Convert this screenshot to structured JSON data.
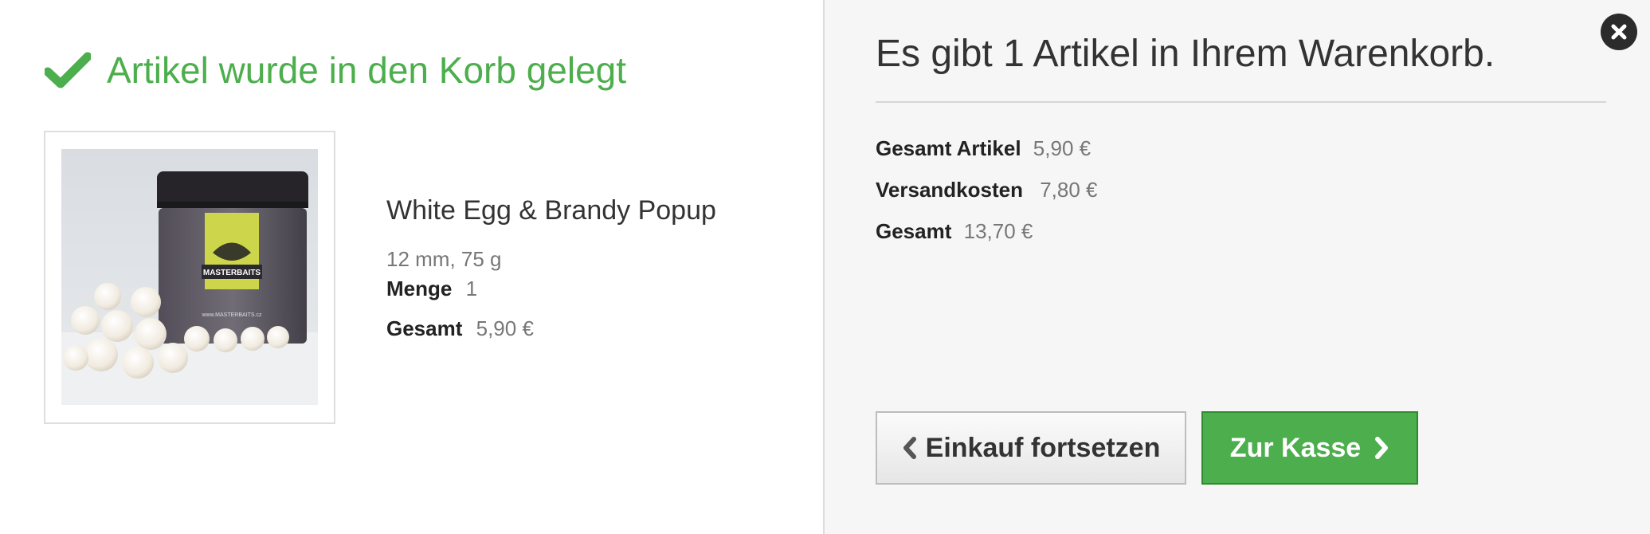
{
  "left": {
    "added_title": "Artikel wurde in den Korb gelegt",
    "product": {
      "name": "White Egg & Brandy Popup",
      "variant": "12 mm, 75 g",
      "quantity_label": "Menge",
      "quantity_value": "1",
      "total_label": "Gesamt",
      "total_value": "5,90 €",
      "image_brand": "MASTERBAITS"
    }
  },
  "right": {
    "cart_title": "Es gibt 1 Artikel in Ihrem Warenkorb.",
    "summary": {
      "items_label": "Gesamt Artikel",
      "items_value": "5,90 €",
      "shipping_label": "Versandkosten",
      "shipping_value": "7,80 €",
      "total_label": "Gesamt",
      "total_value": "13,70 €"
    },
    "continue_label": "Einkauf fortsetzen",
    "checkout_label": "Zur Kasse"
  },
  "icons": {
    "check": "check-icon",
    "close": "close-icon",
    "chevron_left": "chevron-left-icon",
    "chevron_right": "chevron-right-icon"
  },
  "colors": {
    "accent_green": "#4cae4c",
    "close_bg": "#2b2b2b",
    "right_pane_bg": "#f6f6f6"
  }
}
